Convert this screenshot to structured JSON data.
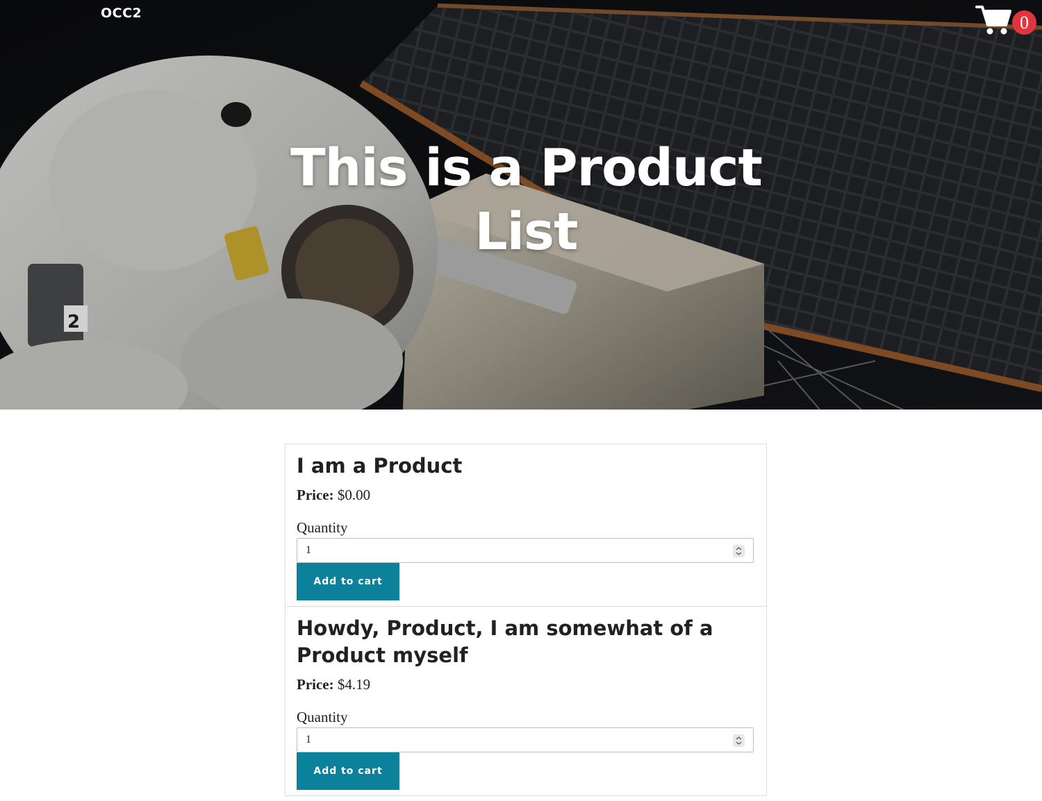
{
  "header": {
    "brand": "OCC2",
    "cart_count": "0",
    "cart_icon": "shopping-cart-icon"
  },
  "hero": {
    "title": "This is a Product List",
    "background": "astronaut-spacewalk-photo"
  },
  "products": [
    {
      "name": "I am a Product",
      "price_label": "Price:",
      "price": "$0.00",
      "quantity_label": "Quantity",
      "quantity": "1",
      "button_label": "Add to cart"
    },
    {
      "name": "Howdy, Product, I am somewhat of a Product myself",
      "price_label": "Price:",
      "price": "$4.19",
      "quantity_label": "Quantity",
      "quantity": "1",
      "button_label": "Add to cart"
    }
  ],
  "colors": {
    "accent": "#0b819b",
    "badge": "#e0353e",
    "text": "#212121"
  }
}
